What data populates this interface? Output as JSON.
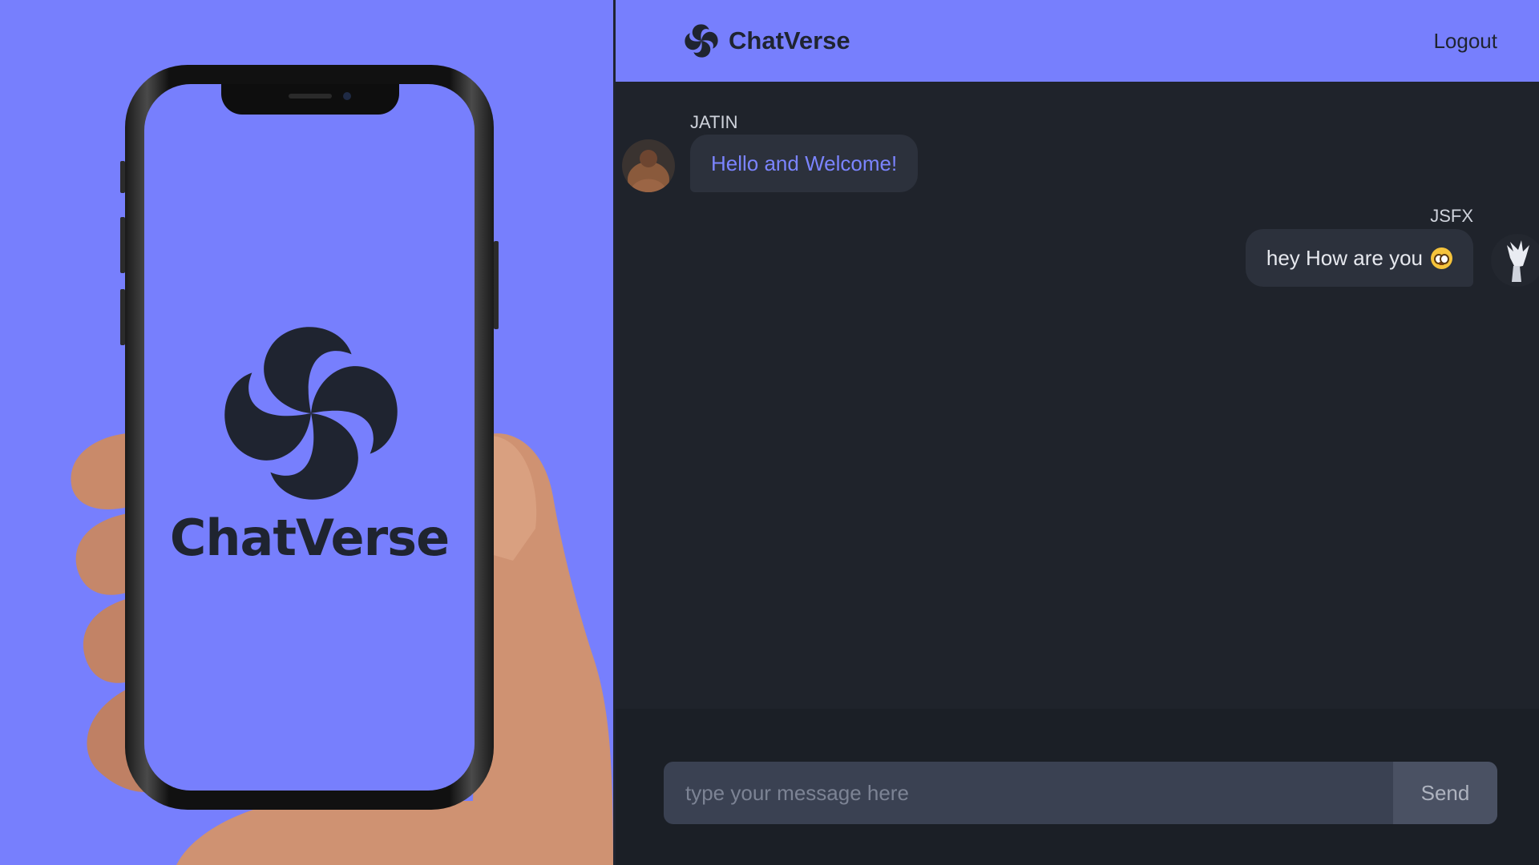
{
  "brand": {
    "name": "ChatVerse"
  },
  "colors": {
    "accent": "#777ffd",
    "app_bg": "#1f232b",
    "bubble": "#2c313c",
    "incoming_text": "#7b84ff"
  },
  "header": {
    "logout_label": "Logout"
  },
  "messages": [
    {
      "sender": "JATIN",
      "text": "Hello and Welcome!",
      "side": "incoming"
    },
    {
      "sender": "JSFX",
      "text": "hey How are you",
      "emoji": "face-emoji",
      "side": "outgoing"
    }
  ],
  "composer": {
    "placeholder": "type your message here",
    "value": "",
    "send_label": "Send"
  },
  "icons": {
    "logo": "swirl-logo-icon",
    "emoji": "face-emoji"
  }
}
